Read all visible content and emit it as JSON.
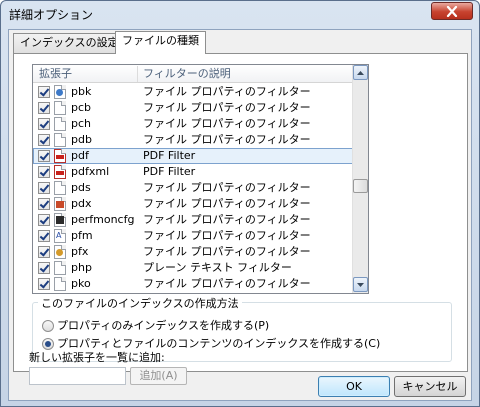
{
  "window": {
    "title": "詳細オプション"
  },
  "tabs": [
    {
      "label": "インデックスの設定"
    },
    {
      "label": "ファイルの種類"
    }
  ],
  "list": {
    "columns": {
      "extension": "拡張子",
      "description": "フィルターの説明"
    },
    "rows": [
      {
        "ext": "pbk",
        "desc": "ファイル プロパティのフィルター",
        "checked": true,
        "icon": "phonebook-icon"
      },
      {
        "ext": "pcb",
        "desc": "ファイル プロパティのフィルター",
        "checked": true,
        "icon": "file-icon"
      },
      {
        "ext": "pch",
        "desc": "ファイル プロパティのフィルター",
        "checked": true,
        "icon": "file-icon"
      },
      {
        "ext": "pdb",
        "desc": "ファイル プロパティのフィルター",
        "checked": true,
        "icon": "file-icon"
      },
      {
        "ext": "pdf",
        "desc": "PDF Filter",
        "checked": true,
        "icon": "pdf-icon",
        "selected": true
      },
      {
        "ext": "pdfxml",
        "desc": "PDF Filter",
        "checked": true,
        "icon": "pdf-icon"
      },
      {
        "ext": "pds",
        "desc": "ファイル プロパティのフィルター",
        "checked": true,
        "icon": "file-icon"
      },
      {
        "ext": "pdx",
        "desc": "ファイル プロパティのフィルター",
        "checked": true,
        "icon": "pdx-icon"
      },
      {
        "ext": "perfmoncfg",
        "desc": "ファイル プロパティのフィルター",
        "checked": true,
        "icon": "perfmon-icon"
      },
      {
        "ext": "pfm",
        "desc": "ファイル プロパティのフィルター",
        "checked": true,
        "icon": "font-icon"
      },
      {
        "ext": "pfx",
        "desc": "ファイル プロパティのフィルター",
        "checked": true,
        "icon": "certificate-icon"
      },
      {
        "ext": "php",
        "desc": "プレーン テキスト フィルター",
        "checked": true,
        "icon": "file-icon"
      },
      {
        "ext": "pko",
        "desc": "ファイル プロパティのフィルター",
        "checked": true,
        "icon": "file-icon"
      }
    ]
  },
  "index_method": {
    "title": "このファイルのインデックスの作成方法",
    "options": [
      {
        "label": "プロパティのみインデックスを作成する(P)",
        "selected": false
      },
      {
        "label": "プロパティとファイルのコンテンツのインデックスを作成する(C)",
        "selected": true
      }
    ]
  },
  "add_extension": {
    "label": "新しい拡張子を一覧に追加:",
    "input_value": "",
    "button_label": "追加(A)"
  },
  "buttons": {
    "ok": "OK",
    "cancel": "キャンセル"
  }
}
